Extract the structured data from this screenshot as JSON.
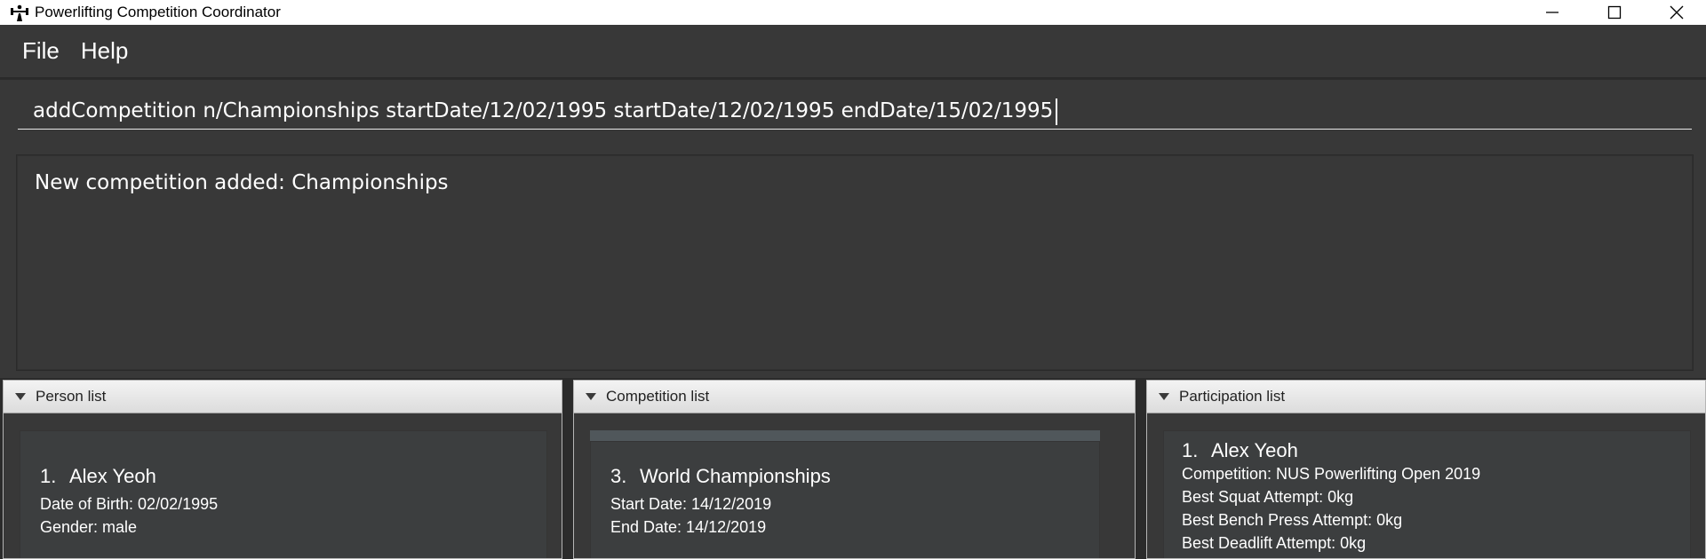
{
  "window": {
    "title": "Powerlifting Competition Coordinator",
    "icon": "barbell-lifter-icon"
  },
  "menu": {
    "file": "File",
    "help": "Help"
  },
  "command": {
    "value": "addCompetition n/Championships startDate/12/02/1995 startDate/12/02/1995 endDate/15/02/1995"
  },
  "result": {
    "text": "New competition added: Championships"
  },
  "person_panel": {
    "title": "Person list",
    "card": {
      "index": "1.",
      "name": "Alex Yeoh",
      "dob": "Date of Birth: 02/02/1995",
      "gender": "Gender: male"
    }
  },
  "competition_panel": {
    "title": "Competition list",
    "card": {
      "index": "3.",
      "name": "World Championships",
      "start": "Start Date: 14/12/2019",
      "end": "End Date: 14/12/2019"
    }
  },
  "participation_panel": {
    "title": "Participation list",
    "card": {
      "index": "1.",
      "name": "Alex Yeoh",
      "competition": "Competition: NUS Powerlifting Open 2019",
      "squat": "Best Squat Attempt: 0kg",
      "bench": "Best Bench Press Attempt: 0kg",
      "deadlift": "Best Deadlift Attempt: 0kg"
    }
  },
  "colors": {
    "background": "#383838",
    "text": "#ffffff",
    "card": "#3c3e3f"
  }
}
